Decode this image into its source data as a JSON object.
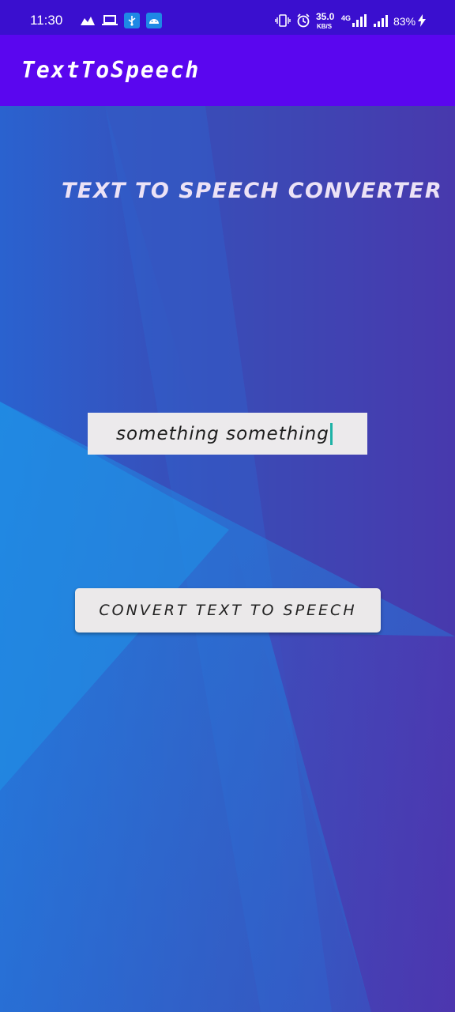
{
  "status_bar": {
    "time": "11:30",
    "speed_value": "35.0",
    "speed_unit": "KB/S",
    "network_type": "4G",
    "battery": "83%",
    "icons": [
      "gallery-icon",
      "laptop-icon",
      "usb-icon",
      "android-icon",
      "vibrate-icon",
      "alarm-icon",
      "signal-icon",
      "signal-icon",
      "charging-icon"
    ]
  },
  "app_bar": {
    "title": "TextToSpeech"
  },
  "main": {
    "heading": "TEXT TO SPEECH CONVERTER",
    "input": {
      "value": "something something"
    },
    "convert_button": "CONVERT TEXT TO SPEECH"
  },
  "colors": {
    "status_bar": "#3a0fcf",
    "app_bar": "#5a06ef",
    "gradient_light_blue": "#1e90e6",
    "gradient_purple": "#5a21a0",
    "caret": "#1eb2a6"
  }
}
